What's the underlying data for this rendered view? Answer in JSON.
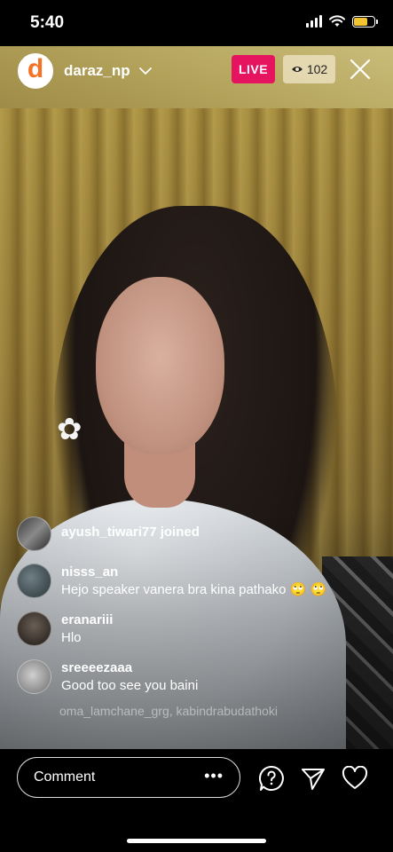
{
  "status_bar": {
    "time": "5:40"
  },
  "header": {
    "host_avatar_letter": "d",
    "host_name": "daraz_np",
    "live_label": "LIVE",
    "viewer_count": "102"
  },
  "comments": [
    {
      "user": "ayush_tiwari77 joined",
      "text": ""
    },
    {
      "user": "nisss_an",
      "text": "Hejo speaker vanera bra kina pathako 🙄 🙄"
    },
    {
      "user": "eranariii",
      "text": "Hlo"
    },
    {
      "user": "sreeeezaaa",
      "text": "Good too see you baini"
    }
  ],
  "faded_comment": "oma_lamchane_grg, kabindrabudathoki",
  "bottom_bar": {
    "comment_placeholder": "Comment",
    "more_label": "•••"
  },
  "colors": {
    "live": "#e6135f",
    "brand": "#f57224"
  }
}
